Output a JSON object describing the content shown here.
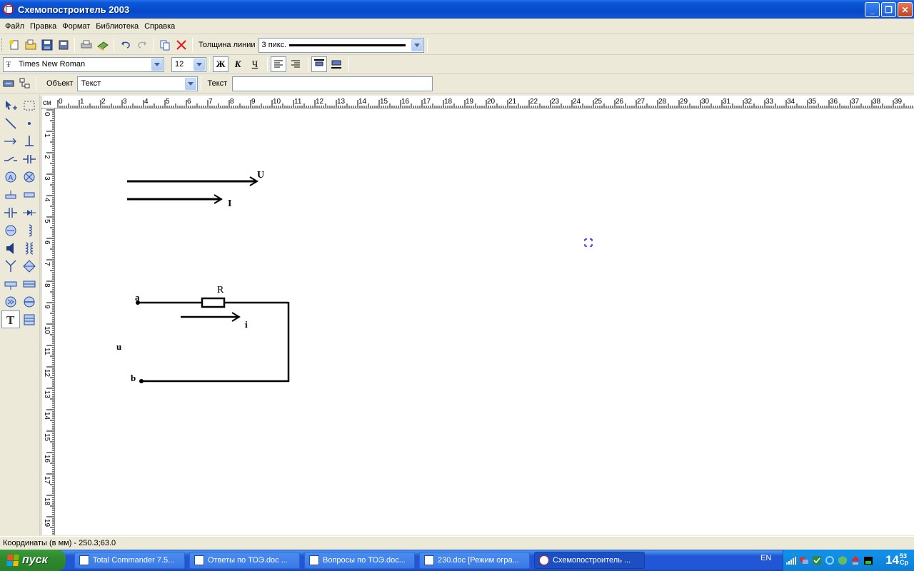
{
  "window": {
    "title": "Схемопостроитель 2003",
    "minimize": "_",
    "maximize": "❐",
    "close": "✕"
  },
  "menu": [
    "Файл",
    "Правка",
    "Формат",
    "Библиотека",
    "Справка"
  ],
  "toolbar1": {
    "line_width_label": "Толщина линии",
    "line_width_value": "3 пикс."
  },
  "toolbar2": {
    "font_name": "Times New Roman",
    "font_size": "12",
    "bold": "Ж",
    "italic": "К",
    "underline": "Ч"
  },
  "toolbar3": {
    "object_label": "Объект",
    "object_value": "Текст",
    "text_label": "Текст",
    "text_value": ""
  },
  "ruler": {
    "unit": "см",
    "h_ticks": [
      "0",
      "1",
      "2",
      "3",
      "4",
      "5",
      "6",
      "7",
      "8",
      "9",
      "10",
      "11",
      "12",
      "13",
      "14",
      "15",
      "16",
      "17",
      "18",
      "19",
      "20",
      "21",
      "22",
      "23",
      "24",
      "25",
      "26",
      "27",
      "28",
      "29",
      "30",
      "31",
      "32",
      "33",
      "34",
      "35",
      "36",
      "37",
      "38",
      "39"
    ],
    "v_ticks": [
      "0",
      "1",
      "2",
      "3",
      "4",
      "5",
      "6",
      "7",
      "8",
      "9",
      "10",
      "11",
      "12",
      "13",
      "14",
      "15",
      "16",
      "17",
      "18",
      "19"
    ]
  },
  "schematic": {
    "label_U": "U",
    "label_I": "I",
    "label_R": "R",
    "label_a": "a",
    "label_b": "b",
    "label_i": "i",
    "label_u": "u"
  },
  "status": {
    "coordinates": "Координаты (в мм) - 250.3;63.0"
  },
  "taskbar": {
    "start": "пуск",
    "tasks": [
      {
        "label": "Total Commander 7.5...",
        "active": false
      },
      {
        "label": "Ответы по ТОЭ.doc ...",
        "active": false
      },
      {
        "label": "Вопросы по ТОЭ.doc...",
        "active": false
      },
      {
        "label": "230.doc [Режим огра...",
        "active": false
      },
      {
        "label": "Схемопостроитель ...",
        "active": true
      }
    ],
    "language": "EN",
    "clock_hours": "14",
    "clock_minutes": "53",
    "clock_day": "Ср"
  },
  "colors": {
    "titlebar": "#0a58d8",
    "taskbar": "#2157d7",
    "start": "#2f8a2f",
    "tray": "#0f7fd6",
    "selection": "#0000ff"
  }
}
